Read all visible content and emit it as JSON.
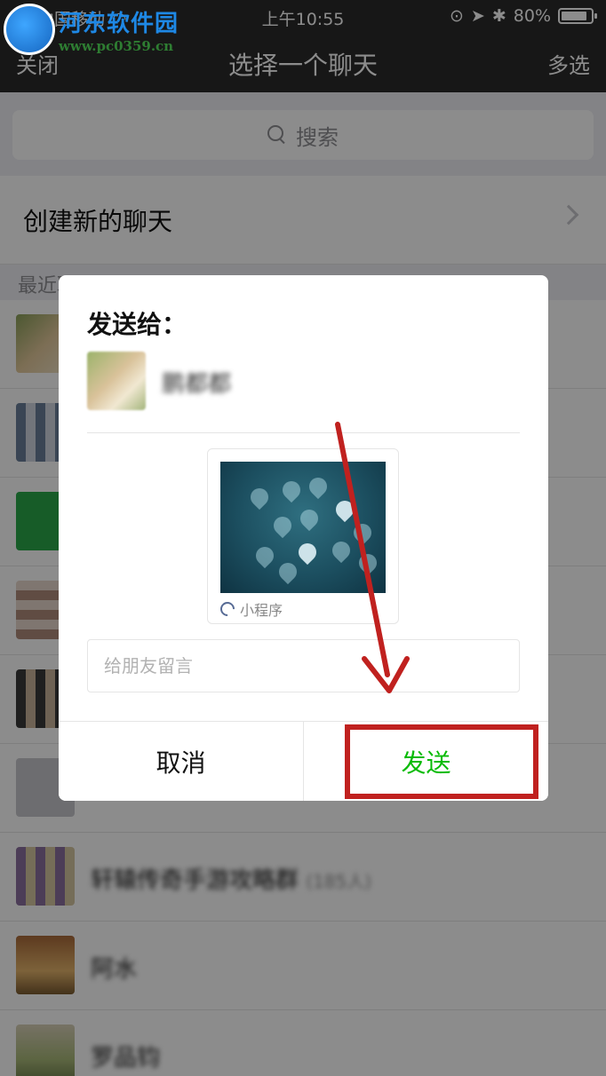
{
  "status_bar": {
    "carrier": "中国移动",
    "time": "上午10:55",
    "battery": "80%"
  },
  "watermark": {
    "title": "河东软件园",
    "url": "www.pc0359.cn"
  },
  "nav": {
    "close_label": "关闭",
    "title": "选择一个聊天",
    "multiselect_label": "多选"
  },
  "search": {
    "placeholder": "搜索"
  },
  "create_chat": {
    "label": "创建新的聊天"
  },
  "recent": {
    "header": "最近聊天",
    "rows": [
      {
        "name": "",
        "count": ""
      },
      {
        "name": "",
        "count": ""
      },
      {
        "name": "",
        "count": ""
      },
      {
        "name": "",
        "count": ""
      },
      {
        "name": "",
        "count": ""
      },
      {
        "name": "",
        "count": ""
      },
      {
        "name": "轩辕传奇手游攻略群",
        "count": "(185人)"
      },
      {
        "name": "阿水",
        "count": ""
      },
      {
        "name": "罗品钧",
        "count": ""
      }
    ]
  },
  "dialog": {
    "title": "发送给：",
    "recipient_name": "鹏都都",
    "mini_program_label": "小程序",
    "message_placeholder": "给朋友留言",
    "cancel_label": "取消",
    "send_label": "发送"
  },
  "colors": {
    "nav_bg": "#2b2b2b",
    "send_green": "#09bb07",
    "annotation_red": "#c0211f"
  }
}
